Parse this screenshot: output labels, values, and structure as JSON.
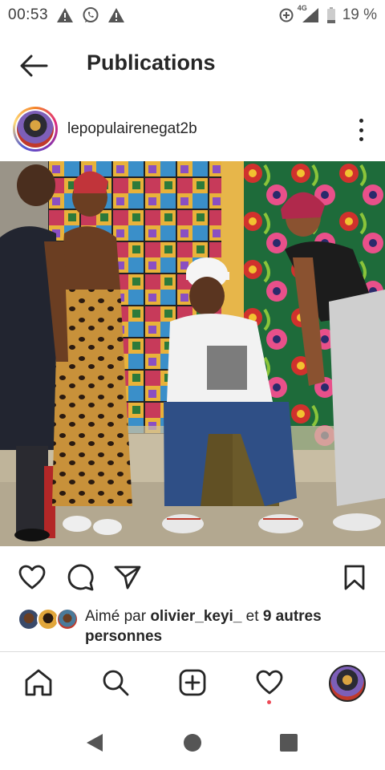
{
  "status_bar": {
    "time": "00:53",
    "network": "4G",
    "battery": "19 %",
    "icons": [
      "warning-icon",
      "whatsapp-icon",
      "warning-icon",
      "data-saver-icon",
      "signal-icon",
      "battery-icon"
    ]
  },
  "header": {
    "title": "Publications",
    "back_icon": "back-arrow-icon"
  },
  "post": {
    "username": "lepopulairenegat2b",
    "more_icon": "more-vertical-icon",
    "actions": [
      "heart-icon",
      "comment-icon",
      "share-icon",
      "bookmark-icon"
    ],
    "likes": {
      "prefix": "Aimé par ",
      "liker": "olivier_keyi_",
      "middle": " et ",
      "others": "9 autres personnes"
    }
  },
  "bottom_nav": {
    "items": [
      "home-icon",
      "search-icon",
      "new-post-icon",
      "activity-icon",
      "profile-avatar"
    ]
  },
  "system_nav": {
    "items": [
      "back-triangle-icon",
      "home-circle-icon",
      "recents-square-icon"
    ]
  },
  "colors": {
    "text": "#262626",
    "notification": "#ed4956",
    "divider": "#dbdbdb"
  }
}
